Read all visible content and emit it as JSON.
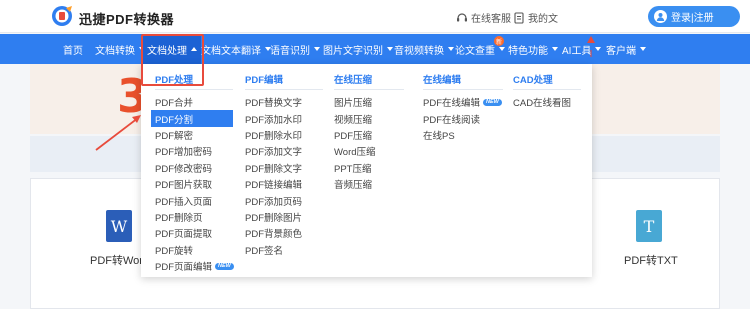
{
  "header": {
    "brand": "迅捷PDF转换器",
    "customer_service": "在线客服",
    "my_files": "我的文",
    "login_label": "登录|注册",
    "brand_color": "#2f7ef0"
  },
  "nav": {
    "items": [
      {
        "label": "首页",
        "has_caret": false
      },
      {
        "label": "文档转换",
        "has_caret": true
      },
      {
        "label": "文档处理",
        "has_caret": true,
        "active": true
      },
      {
        "label": "文档文本翻译",
        "has_caret": true
      },
      {
        "label": "语音识别",
        "has_caret": true
      },
      {
        "label": "图片文字识别",
        "has_caret": true
      },
      {
        "label": "音视频转换",
        "has_caret": true
      },
      {
        "label": "论文查重",
        "has_caret": true,
        "badge": "新"
      },
      {
        "label": "特色功能",
        "has_caret": true
      },
      {
        "label": "AI工具",
        "has_caret": true
      },
      {
        "label": "客户端",
        "has_caret": true
      }
    ]
  },
  "dropdown": {
    "columns": [
      {
        "heading": "PDF处理",
        "items": [
          "PDF合并",
          "PDF分割",
          "PDF解密",
          "PDF增加密码",
          "PDF修改密码",
          "PDF图片获取",
          "PDF插入页面",
          "PDF删除页",
          "PDF页面提取",
          "PDF旋转",
          "PDF页面编辑"
        ],
        "selected_index": 1,
        "new_index": 10
      },
      {
        "heading": "PDF编辑",
        "items": [
          "PDF替换文字",
          "PDF添加水印",
          "PDF删除水印",
          "PDF添加文字",
          "PDF删除文字",
          "PDF链接编辑",
          "PDF添加页码",
          "PDF删除图片",
          "PDF背景颜色",
          "PDF签名"
        ]
      },
      {
        "heading": "在线压缩",
        "items": [
          "图片压缩",
          "视频压缩",
          "PDF压缩",
          "Word压缩",
          "PPT压缩",
          "音频压缩"
        ]
      },
      {
        "heading": "在线编辑",
        "items": [
          "PDF在线编辑",
          "PDF在线阅读",
          "在线PS"
        ],
        "new_index": 0
      },
      {
        "heading": "CAD处理",
        "items": [
          "CAD在线看图"
        ]
      }
    ],
    "new_badge": "NEW"
  },
  "background": {
    "hero_number": "3",
    "cards": [
      {
        "label": "PDF转Word",
        "icon": "word-icon",
        "glyph": "W",
        "color": "#2b5eb8"
      },
      {
        "label": "PDF转TXT",
        "icon": "txt-icon",
        "glyph": "T",
        "color": "#48a8d4"
      }
    ]
  },
  "annotation": {
    "highlight_color": "#e84b3c"
  }
}
